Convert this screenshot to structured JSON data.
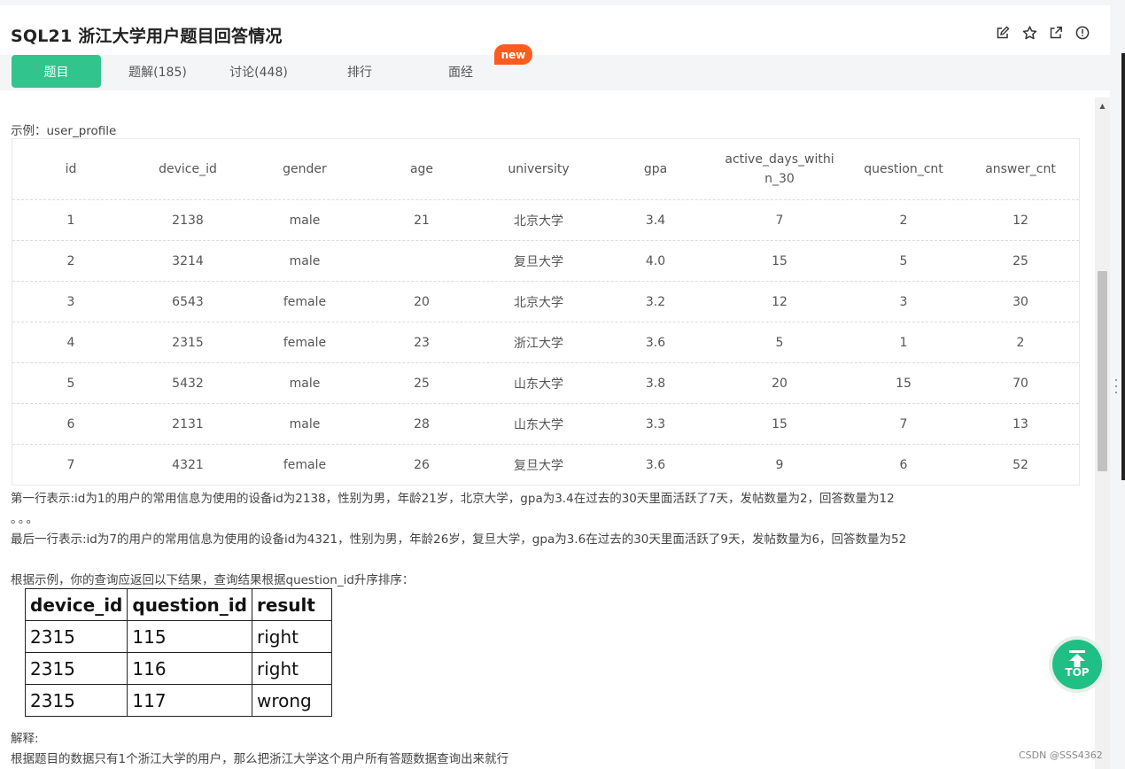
{
  "header": {
    "title": "SQL21  浙江大学用户题目回答情况",
    "icons": [
      "edit-icon",
      "star-icon",
      "external-link-icon",
      "info-icon"
    ]
  },
  "tabs": [
    {
      "label": "题目",
      "active": true
    },
    {
      "label": "题解(185)",
      "active": false
    },
    {
      "label": "讨论(448)",
      "active": false
    },
    {
      "label": "排行",
      "active": false
    },
    {
      "label": "面经",
      "active": false
    }
  ],
  "new_badge": "new",
  "content": {
    "example_label": "示例：user_profile",
    "user_profile": {
      "columns": [
        "id",
        "device_id",
        "gender",
        "age",
        "university",
        "gpa",
        "active_days_within_30",
        "question_cnt",
        "answer_cnt"
      ],
      "rows": [
        [
          "1",
          "2138",
          "male",
          "21",
          "北京大学",
          "3.4",
          "7",
          "2",
          "12"
        ],
        [
          "2",
          "3214",
          "male",
          "",
          "复旦大学",
          "4.0",
          "15",
          "5",
          "25"
        ],
        [
          "3",
          "6543",
          "female",
          "20",
          "北京大学",
          "3.2",
          "12",
          "3",
          "30"
        ],
        [
          "4",
          "2315",
          "female",
          "23",
          "浙江大学",
          "3.6",
          "5",
          "1",
          "2"
        ],
        [
          "5",
          "5432",
          "male",
          "25",
          "山东大学",
          "3.8",
          "20",
          "15",
          "70"
        ],
        [
          "6",
          "2131",
          "male",
          "28",
          "山东大学",
          "3.3",
          "15",
          "7",
          "13"
        ],
        [
          "7",
          "4321",
          "female",
          "26",
          "复旦大学",
          "3.6",
          "9",
          "6",
          "52"
        ]
      ]
    },
    "desc_line1": "第一行表示:id为1的用户的常用信息为使用的设备id为2138，性别为男，年龄21岁，北京大学，gpa为3.4在过去的30天里面活跃了7天，发帖数量为2，回答数量为12",
    "desc_dots": "。。。",
    "desc_line2": "最后一行表示:id为7的用户的常用信息为使用的设备id为4321，性别为男，年龄26岁，复旦大学，gpa为3.6在过去的30天里面活跃了9天，发帖数量为6，回答数量为52",
    "result_intro": "根据示例，你的查询应返回以下结果，查询结果根据question_id升序排序：",
    "result_table": {
      "columns": [
        "device_id",
        "question_id",
        "result"
      ],
      "rows": [
        [
          "2315",
          "115",
          "right"
        ],
        [
          "2315",
          "116",
          "right"
        ],
        [
          "2315",
          "117",
          "wrong"
        ]
      ]
    },
    "explain_label": "解释:",
    "explain_text": "根据题目的数据只有1个浙江大学的用户，那么把浙江大学这个用户所有答题数据查询出来就行"
  },
  "top_button": "TOP",
  "watermark": "CSDN @SSS4362"
}
